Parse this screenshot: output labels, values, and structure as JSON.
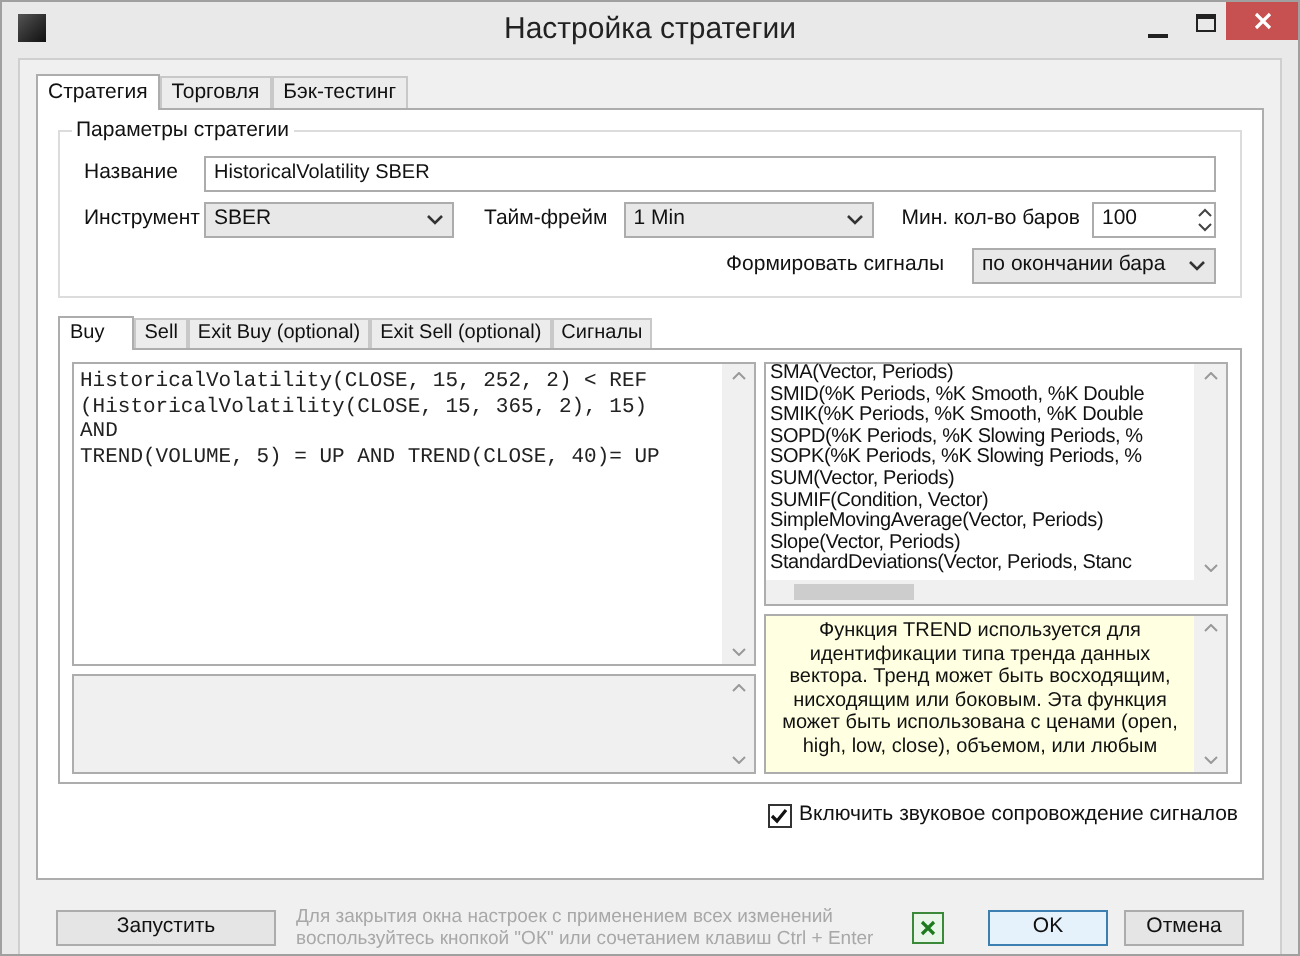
{
  "window": {
    "title": "Настройка стратегии"
  },
  "tabs": [
    {
      "label": "Стратегия",
      "selected": true
    },
    {
      "label": "Торговля",
      "selected": false
    },
    {
      "label": "Бэк-тестинг",
      "selected": false
    }
  ],
  "params": {
    "title": "Параметры стратегии",
    "name": {
      "label": "Название",
      "value": "HistoricalVolatility SBER"
    },
    "instrument": {
      "label": "Инструмент",
      "value": "SBER"
    },
    "timeframe": {
      "label": "Тайм-фрейм",
      "value": "1 Min"
    },
    "min_bars": {
      "label": "Мин. кол-во баров",
      "value": "100"
    },
    "signals": {
      "label": "Формировать сигналы",
      "value": "по окончании бара"
    }
  },
  "inner_tabs": [
    {
      "label": "Buy",
      "selected": true
    },
    {
      "label": "Sell",
      "selected": false
    },
    {
      "label": "Exit Buy (optional)",
      "selected": false
    },
    {
      "label": "Exit Sell (optional)",
      "selected": false
    },
    {
      "label": "Сигналы",
      "selected": false
    }
  ],
  "code_lines": [
    "HistoricalVolatility(CLOSE, 15, 252, 2) < REF",
    "(HistoricalVolatility(CLOSE, 15, 365, 2), 15)",
    "AND",
    "TREND(VOLUME, 5) = UP AND TREND(CLOSE, 40)= UP"
  ],
  "functions": [
    "SMA(Vector, Periods)",
    "SMID(%K Periods, %K Smooth, %K Double",
    "SMIK(%K Periods, %K Smooth, %K Double",
    "SOPD(%K Periods, %K Slowing Periods, %",
    "SOPK(%K Periods, %K Slowing Periods, %",
    "SUM(Vector, Periods)",
    "SUMIF(Condition, Vector)",
    "SimpleMovingAverage(Vector, Periods)",
    "Slope(Vector, Periods)",
    "StandardDeviations(Vector, Periods, Stanc"
  ],
  "description": "Функция TREND используется для идентификации типа тренда данных вектора. Тренд может быть восходящим, нисходящим или боковым. Эта функция может быть использована с ценами (open, high, low, close), объемом, или любым",
  "sound": {
    "label": "Включить звуковое сопровождение сигналов",
    "checked": true
  },
  "footer": {
    "run": "Запустить",
    "hint": "Для закрытия окна настроек с применением всех изменений воспользуйтесь кнопкой \"ОК\" или сочетанием клавиш Ctrl + Enter",
    "ok": "OK",
    "cancel": "Отмена"
  }
}
